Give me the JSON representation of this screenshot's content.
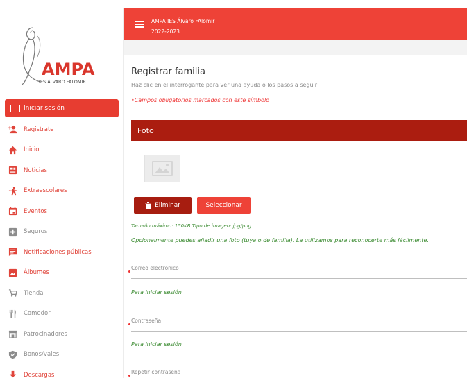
{
  "header": {
    "title": "AMPA IES Álvaro FAlomir",
    "subtitle": "2022-2023"
  },
  "logo": {
    "text": "AMPA",
    "subtext": "IES ÁLVARO FALOMIR"
  },
  "sidebar": {
    "login_label": "Iniciar sesión",
    "items": [
      {
        "label": "Registrate",
        "icon": "add-user-icon"
      },
      {
        "label": "Inicio",
        "icon": "home-icon"
      },
      {
        "label": "Noticias",
        "icon": "news-icon"
      },
      {
        "label": "Extraescolares",
        "icon": "running-icon"
      },
      {
        "label": "Eventos",
        "icon": "calendar-icon"
      },
      {
        "label": "Seguros",
        "icon": "medical-plus-icon"
      },
      {
        "label": "Notificaciones públicas",
        "icon": "message-icon"
      },
      {
        "label": "Álbumes",
        "icon": "photo-icon"
      },
      {
        "label": "Tienda",
        "icon": "cart-icon"
      },
      {
        "label": "Comedor",
        "icon": "cutlery-icon"
      },
      {
        "label": "Patrocinadores",
        "icon": "store-icon"
      },
      {
        "label": "Bonos/vales",
        "icon": "shield-check-icon"
      },
      {
        "label": "Descargas",
        "icon": "download-icon"
      }
    ]
  },
  "colors": {
    "accent": "#ee4237",
    "dark_accent": "#a71d10",
    "hint": "#3a8a30"
  },
  "main": {
    "title": "Registrar familia",
    "help": "Haz clic en el interrogante para ver una ayuda o los pasos a seguir",
    "required_note": "•Campos obligatorios marcados con este símbolo",
    "photo_section": "Foto",
    "delete_label": "Eliminar",
    "select_label": "Seleccionar",
    "size_hint": "Tamaño máximo: 150KB   Tipo de imagen: jpg/png",
    "photo_hint": "Opcionalmente puedes añadir una foto (tuya o de familia). La utilizamos para reconocerte más fácilmente.",
    "email_label": "Correo electrónico",
    "email_hint": "Para iniciar sesión",
    "password_label": "Contraseña",
    "password_hint": "Para iniciar sesión",
    "repeat_label": "Repetir contraseña"
  }
}
